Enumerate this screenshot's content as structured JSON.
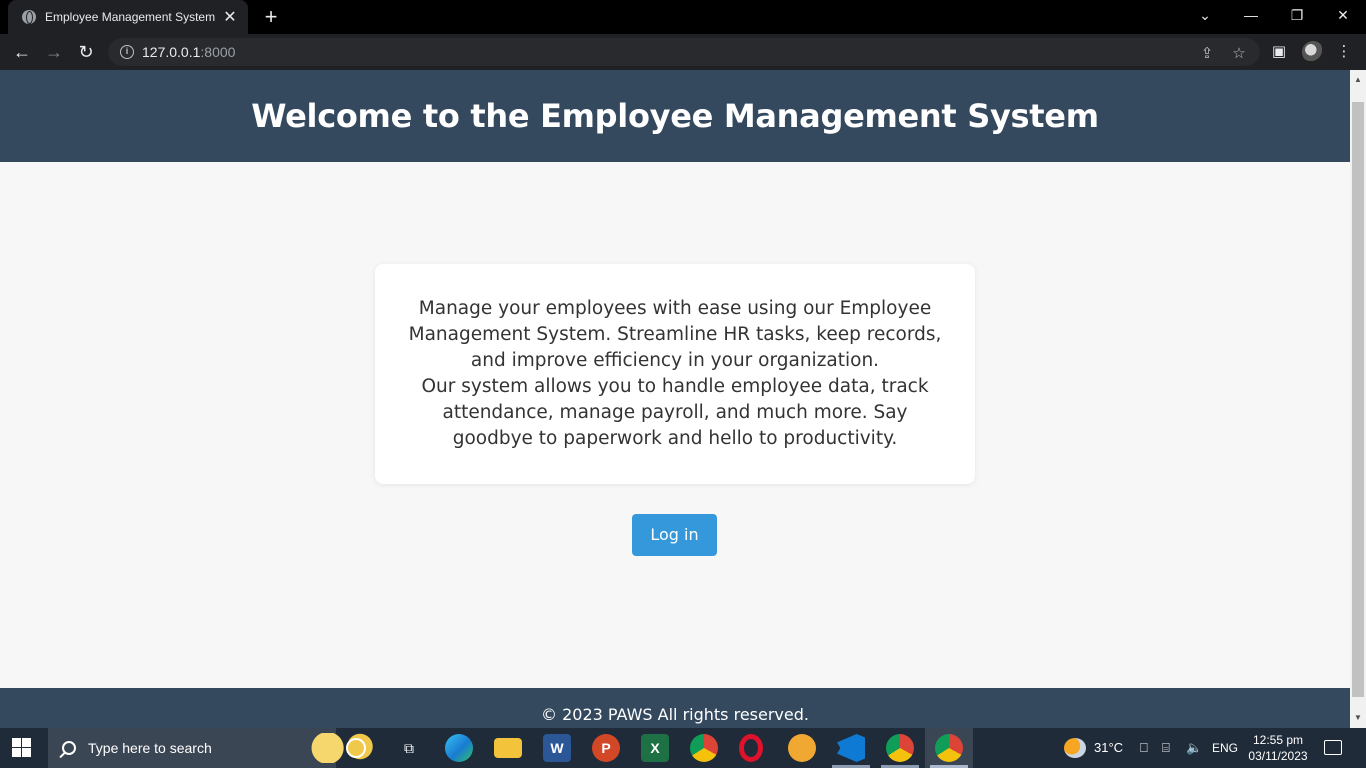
{
  "browser": {
    "tab_title": "Employee Management System",
    "tab_close": "✕",
    "new_tab": "+",
    "url_host": "127.0.0.1",
    "url_port": ":8000",
    "back": "←",
    "forward": "→",
    "reload": "↻",
    "minimize": "—",
    "restore": "❐",
    "close": "✕",
    "tab_search": "⌄",
    "share": "⇪",
    "star": "☆",
    "side_panel": "▣",
    "menu": "⋮"
  },
  "page": {
    "title": "Welcome to the Employee Management System",
    "intro_line1": "Manage your employees with ease using our Employee Management System. Streamline HR tasks, keep records, and improve efficiency in your organization.",
    "intro_line2": "Our system allows you to handle employee data, track attendance, manage payroll, and much more. Say goodbye to paperwork and hello to productivity.",
    "login_label": "Log in",
    "footer": "© 2023 PAWS All rights reserved.",
    "header_color": "#34495e",
    "button_color": "#3498db"
  },
  "taskbar": {
    "search_placeholder": "Type here to search",
    "apps": [
      "cortana-icon",
      "task-view-icon",
      "edge-icon",
      "file-explorer-icon",
      "word-icon",
      "powerpoint-icon",
      "excel-icon",
      "chrome-icon",
      "opera-icon",
      "brave-icon",
      "vscode-icon",
      "chrome-profile-icon",
      "chrome-active-icon"
    ],
    "word_letter": "W",
    "powerpoint_letter": "P",
    "excel_letter": "X",
    "temperature": "31°C",
    "language": "ENG",
    "time": "12:55 pm",
    "date": "03/11/2023"
  }
}
